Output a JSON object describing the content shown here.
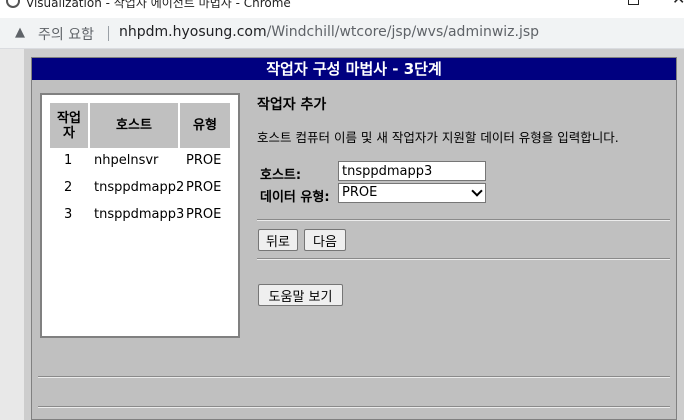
{
  "window": {
    "title": "Visualization - 작업자 에이전트 마법사 - Chrome"
  },
  "address_bar": {
    "warning_icon": "warning-triangle-icon",
    "security_label": "주의 요함",
    "url_host": "nhpdm.hyosung.com",
    "url_path": "/Windchill/wtcore/jsp/wvs/adminwiz.jsp"
  },
  "wizard": {
    "header": "작업자 구성 마법사 - 3단계",
    "table": {
      "headers": {
        "no": "작업자",
        "host": "호스트",
        "type": "유형"
      },
      "rows": [
        {
          "no": "1",
          "host": "nhpelnsvr",
          "type": "PROE"
        },
        {
          "no": "2",
          "host": "tnsppdmapp2",
          "type": "PROE"
        },
        {
          "no": "3",
          "host": "tnsppdmapp3",
          "type": "PROE"
        }
      ]
    },
    "section_title": "작업자 추가",
    "description": "호스트 컴퓨터 이름 및 새 작업자가 지원할 데이터 유형을 입력합니다.",
    "host_label": "호스트:",
    "host_value": "tnsppdmapp3",
    "data_type_label": "데이터 유형:",
    "data_type_value": "PROE",
    "back_button": "뒤로",
    "next_button": "다음",
    "help_button": "도움말 보기"
  }
}
